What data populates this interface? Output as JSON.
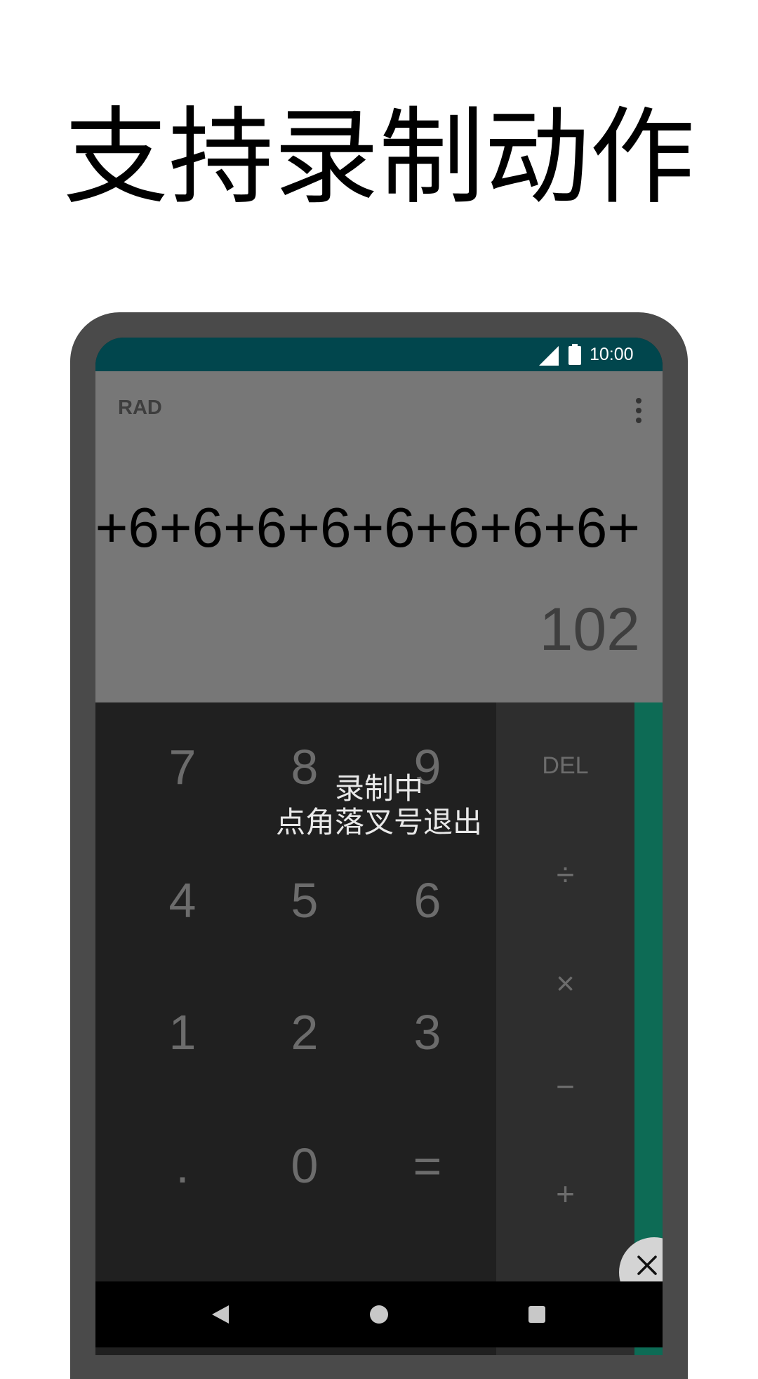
{
  "headline": "支持录制动作",
  "status_bar": {
    "time": "10:00",
    "icons": [
      "signal-icon",
      "battery-icon"
    ]
  },
  "display": {
    "mode": "RAD",
    "expression": "+6+6+6+6+6+6+6+6+",
    "result": "102",
    "menu_icon": "overflow-menu-icon"
  },
  "keypad": {
    "row1": [
      "7",
      "8",
      "9"
    ],
    "row2": [
      "4",
      "5",
      "6"
    ],
    "row3": [
      "1",
      "2",
      "3"
    ],
    "row4": [
      ".",
      "0",
      "="
    ]
  },
  "operators": {
    "del": "DEL",
    "divide": "÷",
    "multiply": "×",
    "minus": "−",
    "plus": "+"
  },
  "overlay": {
    "line1": "录制中",
    "line2": "点角落叉号退出"
  },
  "colors": {
    "status_bar": "#01464d",
    "display_bg": "#777777",
    "keypad_bg": "#202020",
    "ops_bg": "#2e2e2e",
    "side_panel": "#0d6b55",
    "frame": "#4a4a4a"
  },
  "nav": {
    "icons": [
      "back-icon",
      "home-icon",
      "recents-icon"
    ]
  },
  "close_button_icon": "close-icon"
}
